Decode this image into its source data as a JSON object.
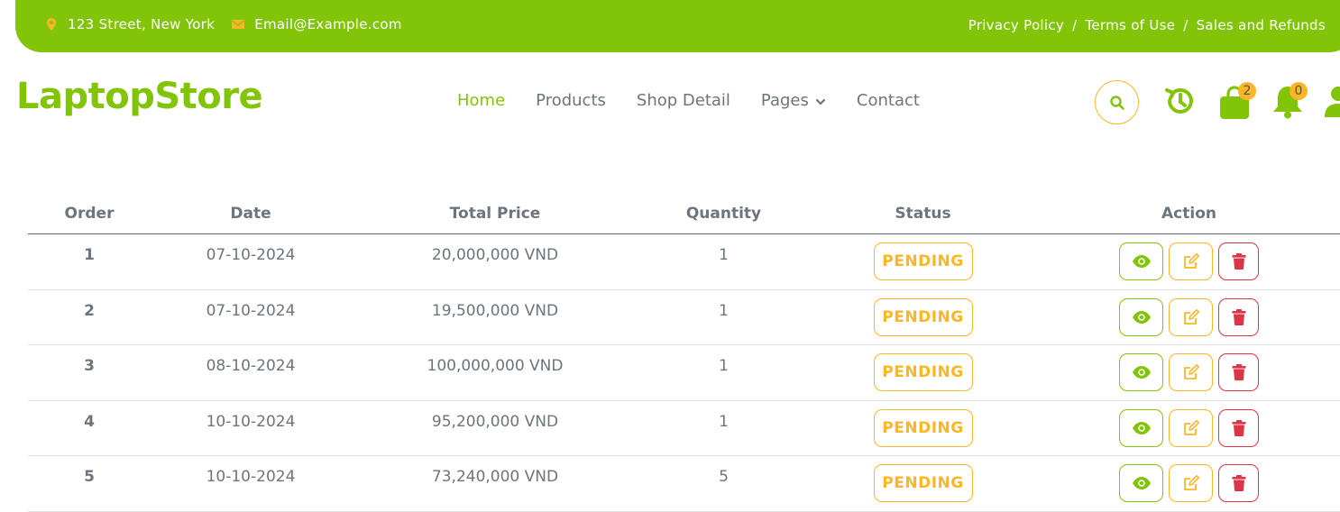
{
  "topbar": {
    "address": "123 Street, New York",
    "email": "Email@Example.com",
    "links": [
      "Privacy Policy",
      "Terms of Use",
      "Sales and Refunds"
    ],
    "separator": "/"
  },
  "brand": "LaptopStore",
  "nav": {
    "items": [
      "Home",
      "Products",
      "Shop Detail",
      "Pages",
      "Contact"
    ],
    "active": "Home"
  },
  "icons": {
    "cart_count": "2",
    "notifications_count": "0"
  },
  "colors": {
    "primary": "#81c408",
    "secondary": "#ffb524",
    "danger": "#dc3545",
    "text": "#6c757d"
  },
  "table": {
    "headers": [
      "Order",
      "Date",
      "Total Price",
      "Quantity",
      "Status",
      "Action"
    ],
    "rows": [
      {
        "order": "1",
        "date": "07-10-2024",
        "total": "20,000,000 VND",
        "qty": "1",
        "status": "PENDING"
      },
      {
        "order": "2",
        "date": "07-10-2024",
        "total": "19,500,000 VND",
        "qty": "1",
        "status": "PENDING"
      },
      {
        "order": "3",
        "date": "08-10-2024",
        "total": "100,000,000 VND",
        "qty": "1",
        "status": "PENDING"
      },
      {
        "order": "4",
        "date": "10-10-2024",
        "total": "95,200,000 VND",
        "qty": "1",
        "status": "PENDING"
      },
      {
        "order": "5",
        "date": "10-10-2024",
        "total": "73,240,000 VND",
        "qty": "5",
        "status": "PENDING"
      }
    ]
  }
}
